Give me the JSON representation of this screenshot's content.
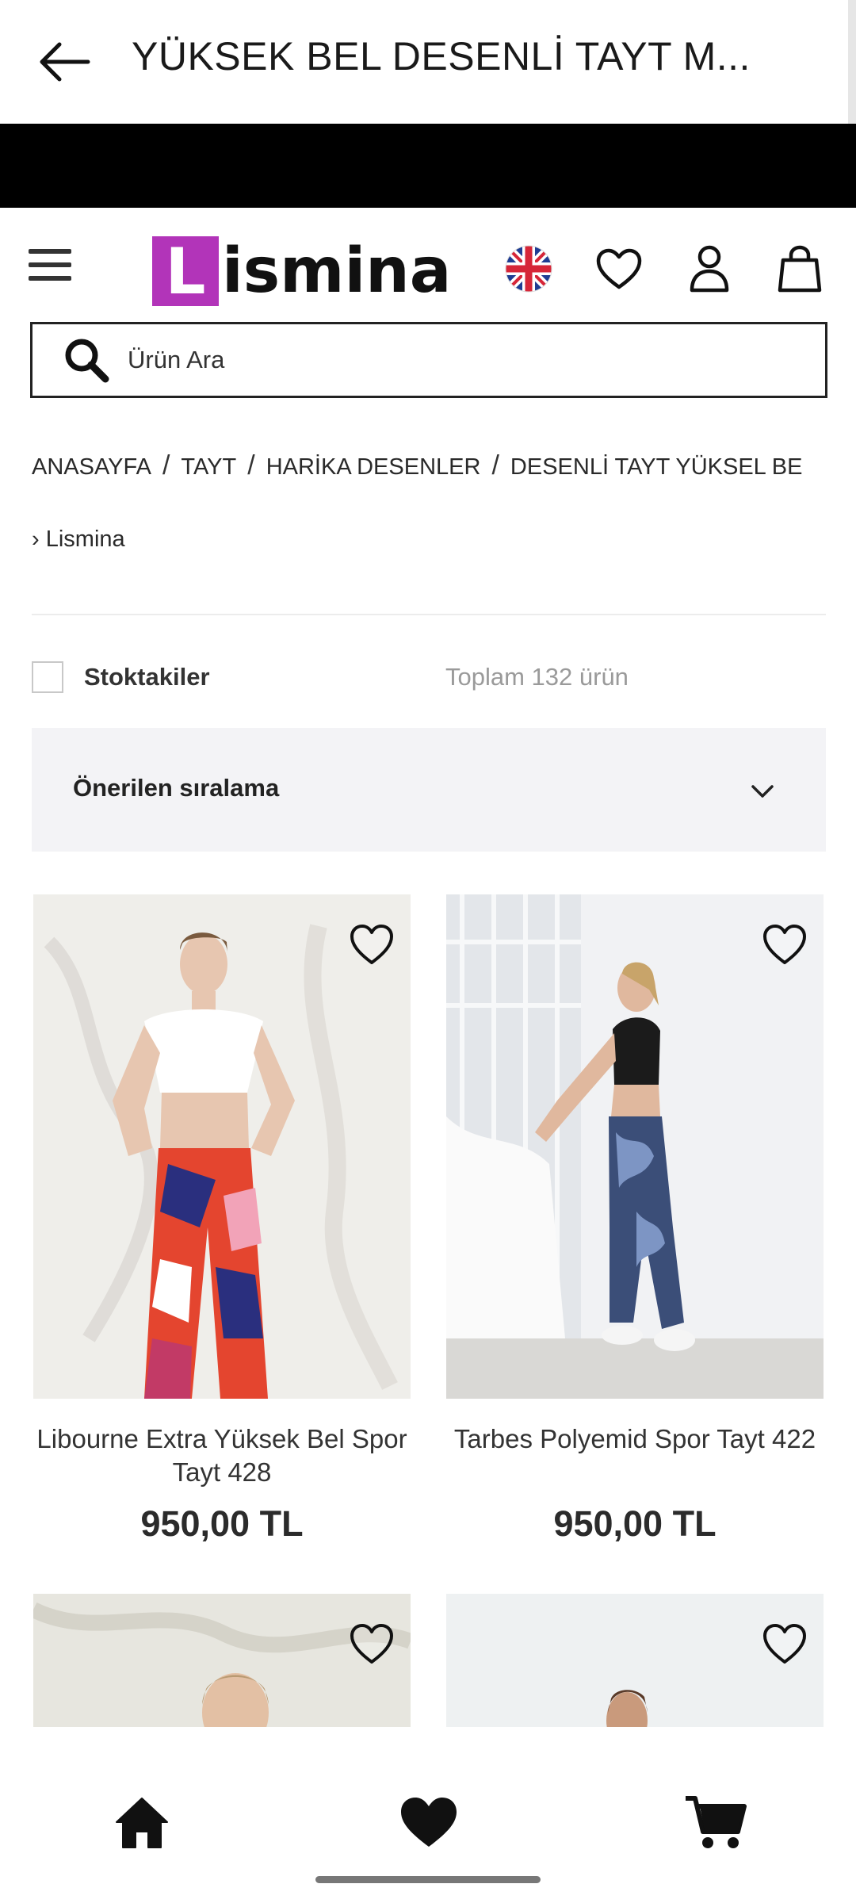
{
  "appbar": {
    "title": "YÜKSEK BEL DESENLİ TAYT M..."
  },
  "brand": {
    "logo_letter": "L",
    "logo_rest": "ismina",
    "logo_color": "#b234b9"
  },
  "search": {
    "placeholder": "Ürün Ara"
  },
  "breadcrumb": {
    "items": [
      "ANASAYFA",
      "TAYT",
      "HARİKA DESENLER",
      "DESENLİ TAYT YÜKSEL BE"
    ],
    "separator": "/",
    "sub": "Lismina",
    "sub_prefix": "›"
  },
  "filters": {
    "in_stock_label": "Stoktakiler",
    "in_stock_checked": false,
    "total_text": "Toplam 132 ürün"
  },
  "sort": {
    "selected": "Önerilen sıralama"
  },
  "products": [
    {
      "name": "Libourne Extra Yüksek Bel Spor Tayt 428",
      "price": "950,00 TL"
    },
    {
      "name": "Tarbes Polyemid Spor Tayt 422",
      "price": "950,00 TL"
    },
    {
      "name": "",
      "price": ""
    },
    {
      "name": "",
      "price": ""
    }
  ],
  "icons": {
    "back": "arrow-left-icon",
    "menu": "hamburger-menu-icon",
    "language": "uk-flag-icon",
    "wishlist": "heart-outline-icon",
    "account": "user-icon",
    "cart": "shopping-bag-icon",
    "search": "search-icon",
    "sort": "chevron-down-icon",
    "nav_home": "home-icon",
    "nav_fav": "heart-filled-icon",
    "nav_cart": "cart-icon"
  }
}
